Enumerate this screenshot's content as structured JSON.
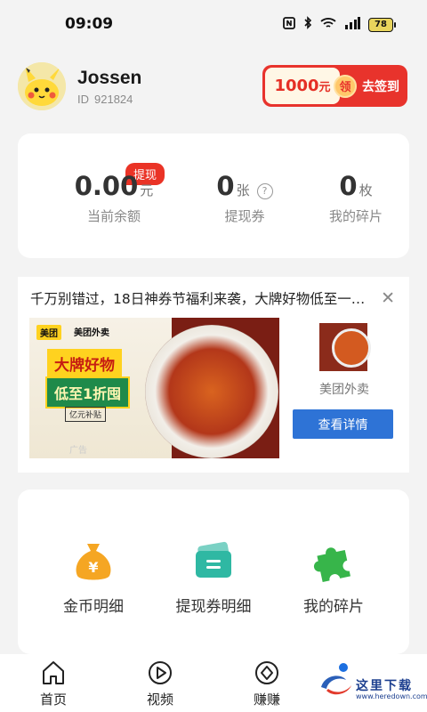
{
  "status_bar": {
    "time": "09:09",
    "battery": "78"
  },
  "profile": {
    "name": "Jossen",
    "id_label": "ID",
    "id_value": "921824"
  },
  "checkin": {
    "amount": "1000",
    "amount_unit": "元",
    "coin_label": "领",
    "action": "去签到"
  },
  "balance": {
    "withdraw_badge": "提现",
    "items": [
      {
        "value": "0.00",
        "unit": "元",
        "label": "当前余额"
      },
      {
        "value": "0",
        "unit": "张",
        "label": "提现券",
        "help": "?"
      },
      {
        "value": "0",
        "unit": "枚",
        "label": "我的碎片"
      }
    ]
  },
  "ad": {
    "headline": "千万别错过，18日神券节福利来袭，大牌好物低至一…",
    "close": "✕",
    "image_text": {
      "logo1": "美团",
      "logo2": "美团外卖",
      "line1": "大牌好物",
      "line2": "低至1折囤",
      "tag": "亿元补贴",
      "ad_label": "广告"
    },
    "brand": "美团外卖",
    "detail_button": "查看详情"
  },
  "shortcuts": [
    {
      "label": "金币明细",
      "icon": "money-bag-icon"
    },
    {
      "label": "提现券明细",
      "icon": "ticket-icon"
    },
    {
      "label": "我的碎片",
      "icon": "puzzle-icon"
    }
  ],
  "tabs": [
    {
      "label": "首页",
      "icon": "home-icon"
    },
    {
      "label": "视频",
      "icon": "play-icon"
    },
    {
      "label": "赚赚",
      "icon": "diamond-icon"
    }
  ],
  "watermark": {
    "text": "这里下载",
    "url": "www.heredown.com"
  }
}
